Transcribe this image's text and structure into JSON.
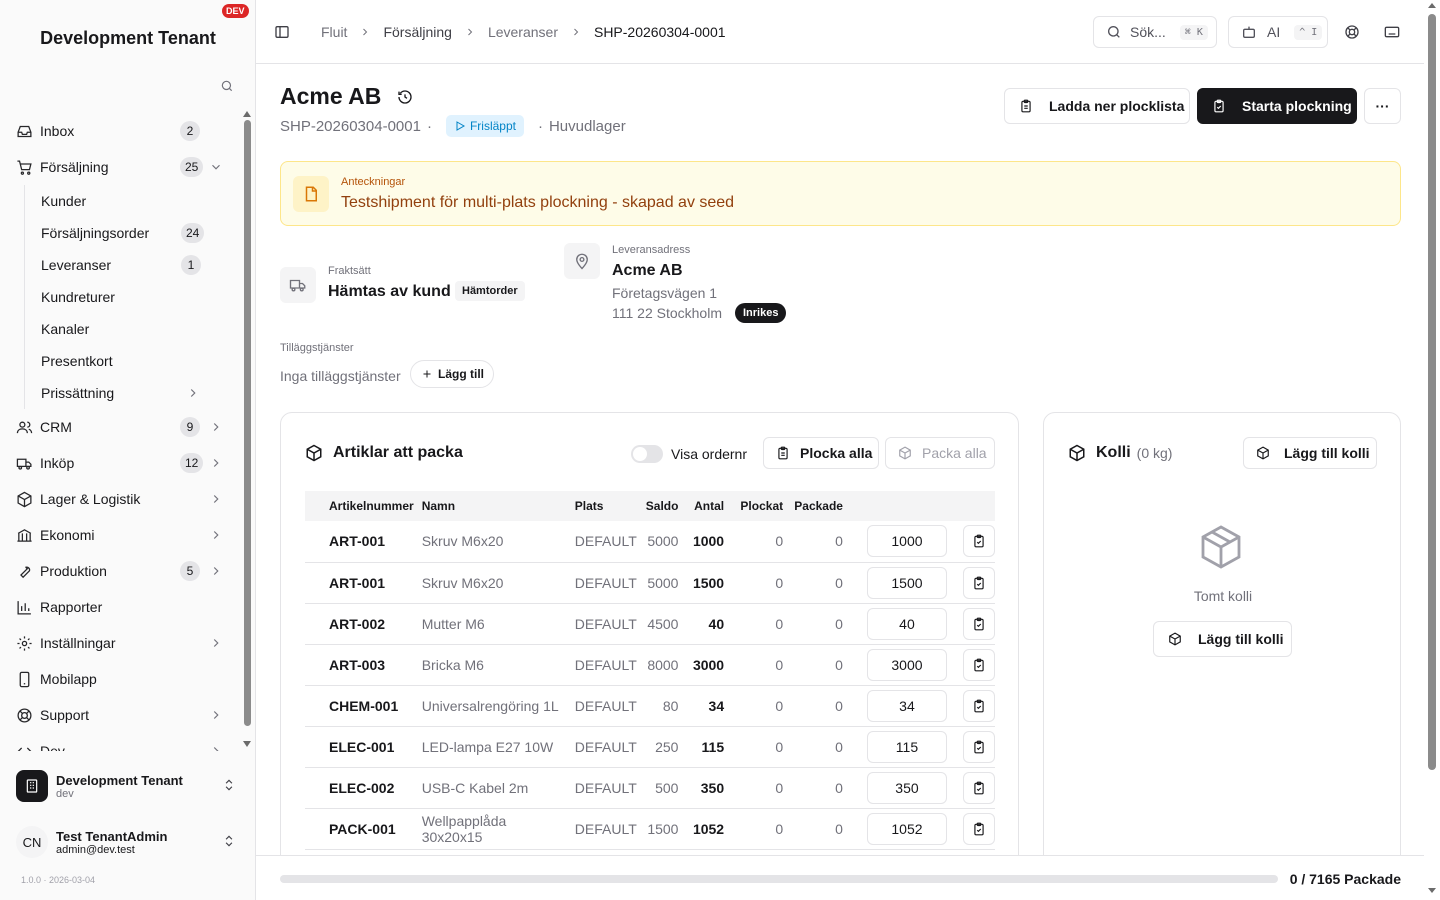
{
  "sidebar": {
    "tenant_title": "Development Tenant",
    "env_badge": "DEV",
    "nav": [
      {
        "label": "Inbox",
        "icon": "inbox-icon",
        "count": "2"
      },
      {
        "label": "Försäljning",
        "icon": "cart-icon",
        "count": "25",
        "expanded": true
      },
      {
        "label": "CRM",
        "icon": "users-icon",
        "count": "9"
      },
      {
        "label": "Inköp",
        "icon": "truck-icon",
        "count": "12"
      },
      {
        "label": "Lager & Logistik",
        "icon": "package-icon"
      },
      {
        "label": "Ekonomi",
        "icon": "bank-icon"
      },
      {
        "label": "Produktion",
        "icon": "wrench-icon",
        "count": "5"
      },
      {
        "label": "Rapporter",
        "icon": "chart-icon"
      },
      {
        "label": "Inställningar",
        "icon": "gear-icon"
      },
      {
        "label": "Mobilapp",
        "icon": "phone-icon"
      },
      {
        "label": "Support",
        "icon": "lifebuoy-icon"
      },
      {
        "label": "Dev",
        "icon": "code-icon"
      }
    ],
    "sales_sub": [
      {
        "label": "Kunder"
      },
      {
        "label": "Försäljningsorder",
        "count": "24"
      },
      {
        "label": "Leveranser",
        "count": "1"
      },
      {
        "label": "Kundreturer"
      },
      {
        "label": "Kanaler"
      },
      {
        "label": "Presentkort"
      },
      {
        "label": "Prissättning"
      }
    ],
    "tenant_switch": {
      "name": "Development Tenant",
      "sub": "dev"
    },
    "user": {
      "initials": "CN",
      "name": "Test TenantAdmin",
      "email": "admin@dev.test"
    },
    "version": "1.0.0 · 2026-03-04"
  },
  "topbar": {
    "breadcrumb": [
      "Fluit",
      "Försäljning",
      "Leveranser",
      "SHP-20260304-0001"
    ],
    "search_label": "Sök...",
    "search_kbd": "⌘ K",
    "ai_label": "AI",
    "ai_kbd": "^ I"
  },
  "header": {
    "title": "Acme AB",
    "shipment_no": "SHP-20260304-0001",
    "status": "Frisläppt",
    "warehouse": "Huvudlager",
    "download_btn": "Ladda ner plocklista",
    "start_btn": "Starta plockning",
    "more_btn": "···"
  },
  "notes": {
    "label": "Anteckningar",
    "text": "Testshipment för multi-plats plockning - skapad av seed"
  },
  "shipping": {
    "label": "Fraktsätt",
    "value": "Hämtas av kund",
    "chip": "Hämtorder"
  },
  "address": {
    "label": "Leveransadress",
    "name": "Acme AB",
    "street": "Företagsvägen 1",
    "city": "111 22 Stockholm",
    "chip": "Inrikes"
  },
  "extras": {
    "label": "Tilläggstjänster",
    "empty": "Inga tilläggstjänster",
    "add_btn": "Lägg till"
  },
  "items": {
    "title": "Artiklar att packa",
    "toggle_label": "Visa ordernr",
    "pick_all": "Plocka alla",
    "pack_all": "Packa alla",
    "columns": [
      "Artikelnummer",
      "Namn",
      "Plats",
      "Saldo",
      "Antal",
      "Plockat",
      "Packade"
    ],
    "rows": [
      {
        "sku": "ART-001",
        "name": "Skruv M6x20",
        "loc": "DEFAULT",
        "stock": "5000",
        "qty": "1000",
        "picked": "0",
        "packed": "0",
        "input": "1000"
      },
      {
        "sku": "ART-001",
        "name": "Skruv M6x20",
        "loc": "DEFAULT",
        "stock": "5000",
        "qty": "1500",
        "picked": "0",
        "packed": "0",
        "input": "1500"
      },
      {
        "sku": "ART-002",
        "name": "Mutter M6",
        "loc": "DEFAULT",
        "stock": "4500",
        "qty": "40",
        "picked": "0",
        "packed": "0",
        "input": "40"
      },
      {
        "sku": "ART-003",
        "name": "Bricka M6",
        "loc": "DEFAULT",
        "stock": "8000",
        "qty": "3000",
        "picked": "0",
        "packed": "0",
        "input": "3000"
      },
      {
        "sku": "CHEM-001",
        "name": "Universalrengöring 1L",
        "loc": "DEFAULT",
        "stock": "80",
        "qty": "34",
        "picked": "0",
        "packed": "0",
        "input": "34"
      },
      {
        "sku": "ELEC-001",
        "name": "LED-lampa E27 10W",
        "loc": "DEFAULT",
        "stock": "250",
        "qty": "115",
        "picked": "0",
        "packed": "0",
        "input": "115"
      },
      {
        "sku": "ELEC-002",
        "name": "USB-C Kabel 2m",
        "loc": "DEFAULT",
        "stock": "500",
        "qty": "350",
        "picked": "0",
        "packed": "0",
        "input": "350"
      },
      {
        "sku": "PACK-001",
        "name": "Wellpapplåda 30x20x15",
        "loc": "DEFAULT",
        "stock": "1500",
        "qty": "1052",
        "picked": "0",
        "packed": "0",
        "input": "1052"
      }
    ]
  },
  "kolli": {
    "title": "Kolli",
    "weight": "(0 kg)",
    "add_btn": "Lägg till kolli",
    "empty": "Tomt kolli",
    "add_btn2": "Lägg till kolli"
  },
  "footer": {
    "packed_text": "0 / 7165 Packade",
    "progress": 0
  }
}
